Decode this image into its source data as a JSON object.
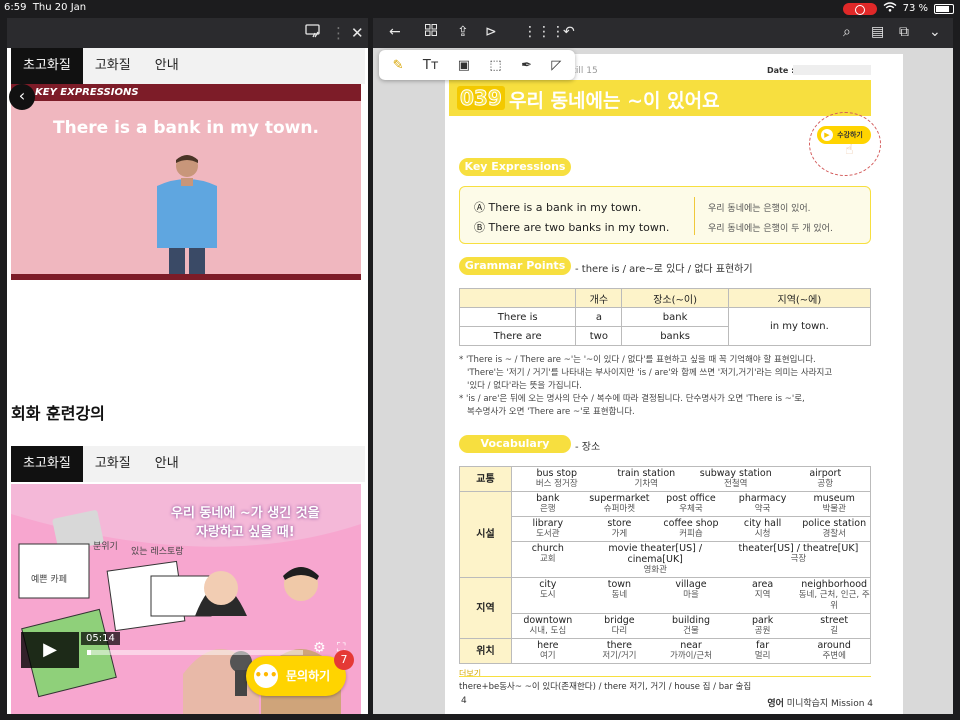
{
  "status": {
    "time": "6:59",
    "date": "Thu 20 Jan",
    "battery": "73 %"
  },
  "left": {
    "tabs1": [
      "초고화질",
      "고화질",
      "안내"
    ],
    "video1": {
      "banner": "KEY EXPRESSIONS",
      "title": "There is a bank in my town."
    },
    "section_title": "회화 훈련강의",
    "tabs2": [
      "초고화질",
      "고화질",
      "안내"
    ],
    "video2": {
      "title_line1": "우리 동네에 ~가 생긴 것을",
      "title_line2": "자랑하고 싶을 때!",
      "hand1": "분위기",
      "hand2": "있는 레스토랑",
      "hand3": "예쁜 카페",
      "time": "05:14",
      "progress": 0.02
    },
    "chat_label": "문의하기",
    "badge_count": "7"
  },
  "right": {
    "page": {
      "skill": "Skill 15",
      "date_label": "Date :",
      "lesson_num": "039",
      "lesson_title": "우리 동네에는 ~이 있어요",
      "susgang": "수강하기",
      "key_expressions": "Key Expressions",
      "ke": [
        {
          "en": "Ⓐ There is a bank in my town.",
          "kr": "우리 동네에는 은행이 있어."
        },
        {
          "en": "Ⓑ There are two banks in my town.",
          "kr": "우리 동네에는 은행이 두 개 있어."
        }
      ],
      "grammar_points": "Grammar Points",
      "grammar_desc": "- there is / are~로 있다 / 없다 표현하기",
      "gp_headers": [
        "",
        "개수",
        "장소(~이)",
        "지역(~에)"
      ],
      "gp_rows": [
        [
          "There is",
          "a",
          "bank"
        ],
        [
          "There are",
          "two",
          "banks"
        ]
      ],
      "gp_merged": "in my town.",
      "notes": [
        "* 'There is ~ / There are ~'는 '~이 있다 / 없다'를 표현하고 싶을 때 꼭 기억해야 할 표현입니다.",
        "'There'는 '저기 / 거기'를 나타내는 부사이지만 'is / are'와 함께 쓰면 '저기,거기'라는 의미는 사라지고",
        "'있다 / 없다'라는 뜻을 가집니다.",
        "* 'is / are'은 뒤에 오는 명사의 단수 / 복수에 따라 결정됩니다. 단수명사가 오면 'There is ~'로,",
        "복수명사가 오면 'There are ~'로 표현합니다."
      ],
      "vocabulary": "Vocabulary",
      "vocab_desc": "- 장소",
      "vocab": [
        {
          "cat": "교통",
          "rows": [
            [
              [
                "bus stop",
                "버스 정거장"
              ],
              [
                "train station",
                "기차역"
              ],
              [
                "subway station",
                "전철역"
              ],
              [
                "airport",
                "공항"
              ]
            ]
          ]
        },
        {
          "cat": "시설",
          "rows": [
            [
              [
                "bank",
                "은행"
              ],
              [
                "supermarket",
                "슈퍼마켓"
              ],
              [
                "post office",
                "우체국"
              ],
              [
                "pharmacy",
                "약국"
              ],
              [
                "museum",
                "박물관"
              ]
            ],
            [
              [
                "library",
                "도서관"
              ],
              [
                "store",
                "가게"
              ],
              [
                "coffee shop",
                "커피숍"
              ],
              [
                "city hall",
                "시청"
              ],
              [
                "police station",
                "경찰서"
              ]
            ],
            [
              [
                "church",
                "교회"
              ],
              [
                "movie theater[US] / cinema[UK]",
                "영화관"
              ],
              [
                "theater[US] / theatre[UK]",
                "극장"
              ]
            ]
          ]
        },
        {
          "cat": "지역",
          "rows": [
            [
              [
                "city",
                "도시"
              ],
              [
                "town",
                "동네"
              ],
              [
                "village",
                "마을"
              ],
              [
                "area",
                "지역"
              ],
              [
                "neighborhood",
                "동네, 근처, 인근, 주위"
              ]
            ],
            [
              [
                "downtown",
                "시내, 도심"
              ],
              [
                "bridge",
                "다리"
              ],
              [
                "building",
                "건물"
              ],
              [
                "park",
                "공원"
              ],
              [
                "street",
                "길"
              ]
            ]
          ]
        },
        {
          "cat": "위치",
          "rows": [
            [
              [
                "here",
                "여기"
              ],
              [
                "there",
                "저기/거기"
              ],
              [
                "near",
                "가까이/근처"
              ],
              [
                "far",
                "멀리"
              ],
              [
                "around",
                "주변에"
              ]
            ]
          ]
        }
      ],
      "extra_label": "더보기",
      "extra_text": "there+be동사~ ~이 있다(존재한다) / there 저기, 거기 / house 집 / bar 술집",
      "page_num": "4",
      "footer_bold": "영어",
      "footer_rest": " 미니학습지  Mission 4"
    }
  }
}
